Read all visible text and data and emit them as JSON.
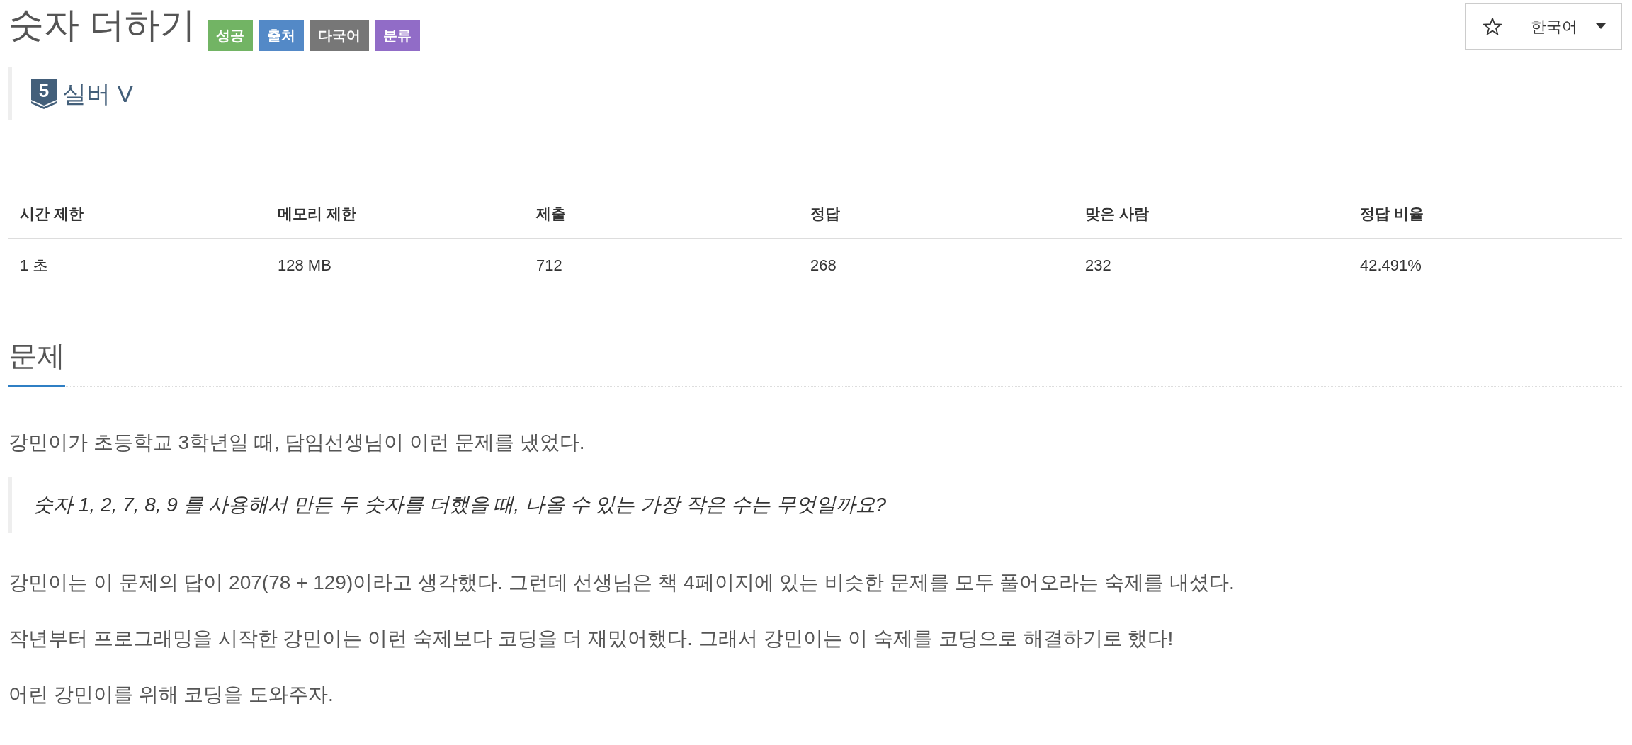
{
  "header": {
    "title": "숫자 더하기",
    "labels": [
      {
        "text": "성공",
        "color": "#72b464"
      },
      {
        "text": "출처",
        "color": "#5389c7"
      },
      {
        "text": "다국어",
        "color": "#777777"
      },
      {
        "text": "분류",
        "color": "#916cc7"
      }
    ]
  },
  "toolbar": {
    "favorite": {
      "starred": false
    },
    "language": {
      "value": "한국어"
    }
  },
  "tier": {
    "number": "5",
    "name": "실버 V"
  },
  "stats": {
    "columns": [
      "시간 제한",
      "메모리 제한",
      "제출",
      "정답",
      "맞은 사람",
      "정답 비율"
    ],
    "rows": [
      [
        "1 초",
        "128 MB",
        "712",
        "268",
        "232",
        "42.491%"
      ]
    ]
  },
  "problem": {
    "heading": "문제",
    "blocks": [
      {
        "kind": "paragraph",
        "text": "강민이가 초등학교 3학년일 때, 담임선생님이 이런 문제를 냈었다."
      },
      {
        "kind": "quote",
        "text": "숫자 1, 2, 7, 8, 9 를 사용해서 만든 두 숫자를 더했을 때, 나올 수 있는 가장 작은 수는 무엇일까요?"
      },
      {
        "kind": "paragraph",
        "text": "강민이는 이 문제의 답이 207(78 + 129)이라고 생각했다. 그런데 선생님은 책 4페이지에 있는 비슷한 문제를 모두 풀어오라는 숙제를 내셨다."
      },
      {
        "kind": "paragraph",
        "text": "작년부터 프로그래밍을 시작한 강민이는 이런 숙제보다 코딩을 더 재밌어했다. 그래서 강민이는 이 숙제를 코딩으로 해결하기로 했다!"
      },
      {
        "kind": "paragraph",
        "text": "어린 강민이를 위해 코딩을 도와주자."
      }
    ]
  }
}
